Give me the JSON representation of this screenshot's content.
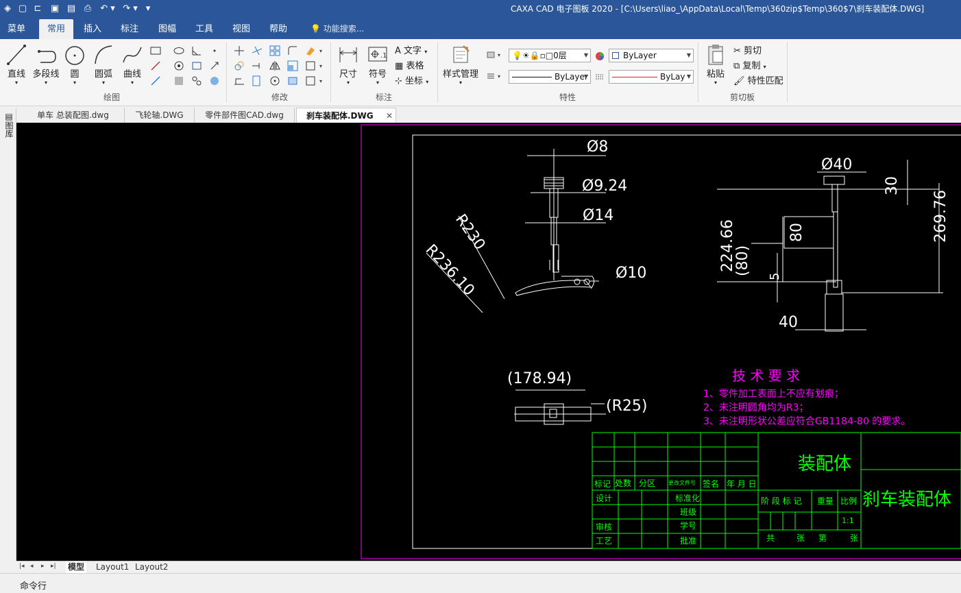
{
  "titlebar": {
    "title": "CAXA CAD 电子图板 2020 - [C:\\Users\\liao_\\AppData\\Local\\Temp\\360zip$Temp\\360$7\\刹车装配体.DWG]",
    "quick_access": [
      "new-icon",
      "open-icon",
      "save-icon",
      "save-as-icon",
      "print-icon",
      "undo-icon",
      "redo-icon",
      "customize-icon"
    ]
  },
  "menubar": {
    "items": [
      "菜单",
      "常用",
      "插入",
      "标注",
      "图幅",
      "工具",
      "视图",
      "帮助"
    ],
    "active": "常用",
    "search_hint": "功能搜索..."
  },
  "ribbon": {
    "groups": {
      "draw": "绘图",
      "modify": "修改",
      "annotate": "标注",
      "properties": "特性",
      "clipboard": "剪切板"
    },
    "draw_buttons": [
      "直线",
      "多段线",
      "圆",
      "圆弧",
      "曲线"
    ],
    "annotate_buttons": {
      "dimension": "尺寸",
      "symbol": "符号",
      "text": "文字",
      "table": "表格",
      "coordinate": "坐标"
    },
    "style_manager": "样式管理",
    "layer_combo": "0层",
    "color_combo": "ByLayer",
    "linetype_combo": "ByLayer",
    "lineweight_combo": "ByLay",
    "clipboard_buttons": {
      "paste": "粘贴",
      "cut": "剪切",
      "copy": "复制",
      "match": "特性匹配"
    },
    "colors": {
      "accent": "#2b579a",
      "ribbon_bg": "#f5f5f5"
    }
  },
  "doc_tabs": {
    "items": [
      "单车 总装配图.dwg",
      "飞轮轴.DWG",
      "零件部件图CAD.dwg",
      "刹车装配体.DWG"
    ],
    "active": "刹车装配体.DWG",
    "side_label": "图库"
  },
  "drawing": {
    "dims_left": [
      "Ø8",
      "Ø9.24",
      "Ø14",
      "Ø10",
      "R230",
      "R236.10"
    ],
    "dims_right": [
      "Ø40",
      "30",
      "80",
      "(80)",
      "5",
      "224.66",
      "269.76",
      "40"
    ],
    "dims_bottom": [
      "(178.94)",
      "(R25)"
    ],
    "tech_title": "技 术 要 求",
    "tech_notes": [
      "1、零件加工表面上不应有划痕；",
      "2、未注明圆角均为R3；",
      "3、未注明形状公差应符合GB1184-80 的要求。"
    ],
    "title_block": {
      "part_name": "装配体",
      "drawing_name": "刹车装配体",
      "row_headers": [
        "标记",
        "处数",
        "分区",
        "更改文件号",
        "签名",
        "年 月 日"
      ],
      "design": "设计",
      "standard": "标准化",
      "stage": "阶 段 标 记",
      "weight": "重量",
      "scale": "比例",
      "scale_value": "1:1",
      "class": "班级",
      "review": "审核",
      "student_id": "学号",
      "process": "工艺",
      "approve": "批准",
      "sheets": [
        "共",
        "张",
        "第",
        "张"
      ]
    },
    "colors": {
      "line": "#ffffff",
      "dim": "#ffffff",
      "text_magenta": "#ff00ff",
      "title_green": "#00ff00",
      "frame_magenta": "#ff00ff"
    }
  },
  "layout_tabs": {
    "items": [
      "模型",
      "Layout1",
      "Layout2"
    ],
    "active": "模型"
  },
  "command_line": {
    "label": "命令行"
  }
}
